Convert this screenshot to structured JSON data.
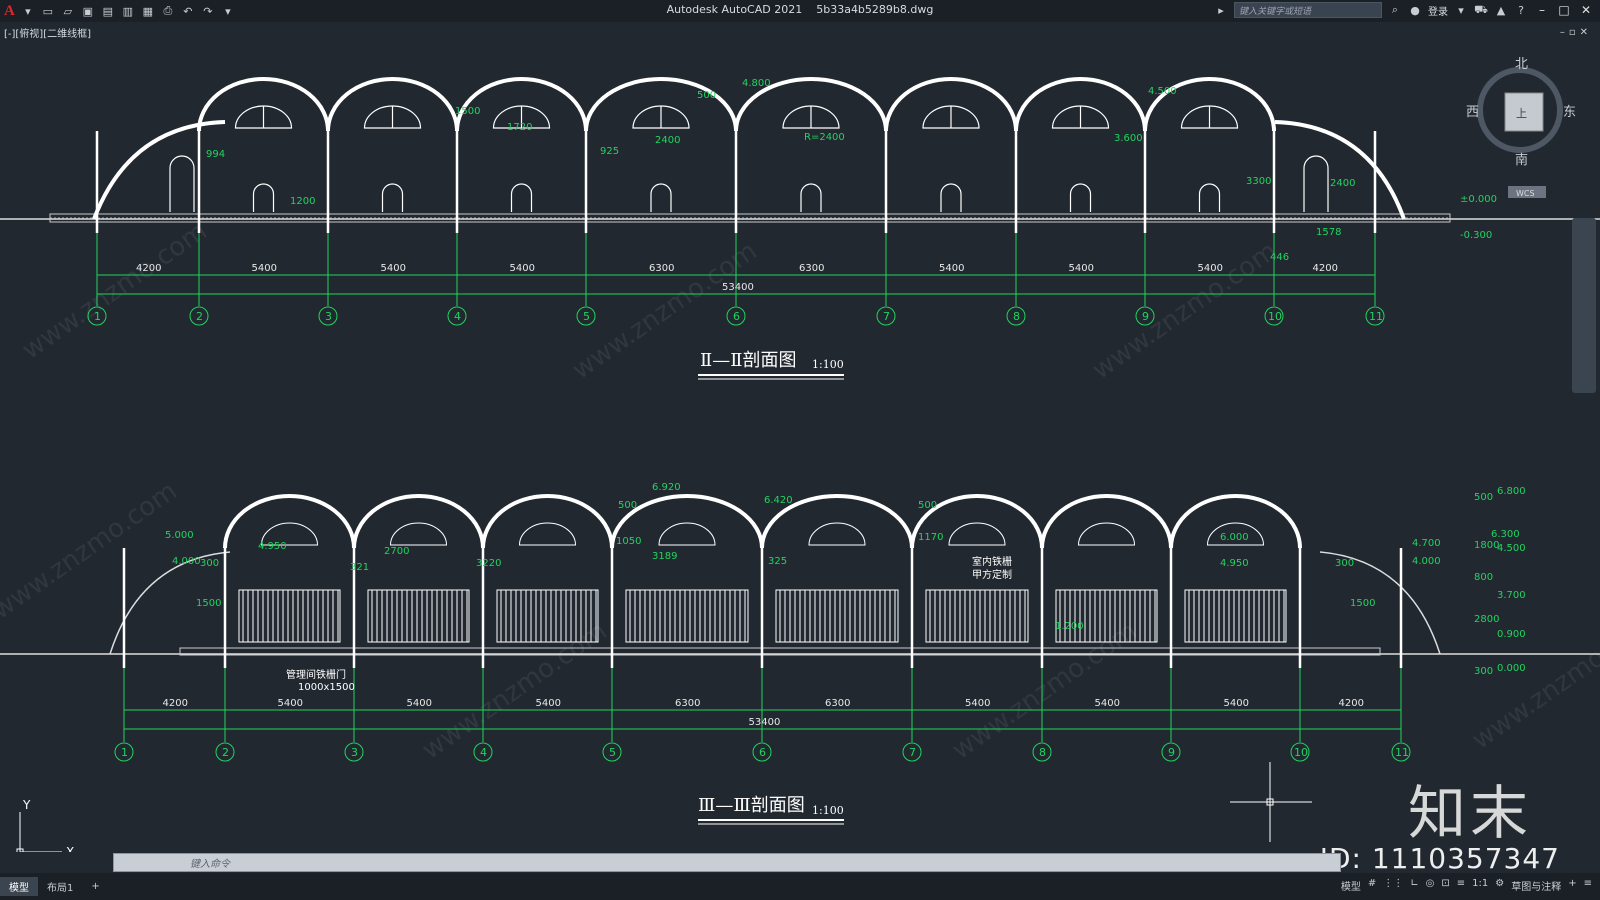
{
  "app": {
    "logo": "A",
    "title": "Autodesk AutoCAD 2021",
    "file": "5b33a4b5289b8.dwg",
    "search_placeholder": "键入关键字或短语",
    "login": "登录"
  },
  "viewport": {
    "label": "[-][俯视][二维线框]"
  },
  "viewcube": {
    "north": "北",
    "south": "南",
    "west": "西",
    "east": "东",
    "face": "上",
    "wcs": "WCS"
  },
  "section1": {
    "title": "Ⅱ—Ⅱ剖面图",
    "scale": "1:100",
    "spans": [
      "4200",
      "5400",
      "5400",
      "5400",
      "6300",
      "6300",
      "5400",
      "5400",
      "5400",
      "4200"
    ],
    "total": "53400",
    "axes": [
      "1",
      "2",
      "3",
      "4",
      "5",
      "6",
      "7",
      "8",
      "9",
      "10",
      "11"
    ],
    "levels": [
      "4.800",
      "4.500",
      "3.600",
      "±0.000",
      "-0.300"
    ],
    "dims": [
      "994",
      "1200",
      "1500",
      "1720",
      "925",
      "2400",
      "500",
      "3300",
      "2400",
      "1578",
      "446",
      "R=2400"
    ]
  },
  "section2": {
    "title": "Ⅲ—Ⅲ剖面图",
    "scale": "1:100",
    "spans": [
      "4200",
      "5400",
      "5400",
      "5400",
      "6300",
      "6300",
      "5400",
      "5400",
      "5400",
      "4200"
    ],
    "total": "53400",
    "axes": [
      "1",
      "2",
      "3",
      "4",
      "5",
      "6",
      "7",
      "8",
      "9",
      "10",
      "11"
    ],
    "levels": [
      "5.000",
      "4.000",
      "4.950",
      "6.920",
      "6.420",
      "6.000",
      "4.950",
      "4.700",
      "4.000",
      "6.800",
      "6.300",
      "4.500",
      "3.700",
      "0.900",
      "0.000",
      "1.200"
    ],
    "dims": [
      "300",
      "1500",
      "321",
      "2700",
      "3220",
      "1050",
      "500",
      "3189",
      "325",
      "1170",
      "500",
      "1500",
      "300",
      "500",
      "1800",
      "800",
      "2800",
      "300"
    ],
    "notes": [
      "室内铁栅",
      "甲方定制",
      "管理间铁栅门",
      "1000x1500"
    ]
  },
  "commandline": {
    "placeholder": "键入命令"
  },
  "status": {
    "tabs": [
      "模型",
      "布局1",
      "+"
    ],
    "model": "模型",
    "scale": "1:1",
    "workspace": "草图与注释"
  },
  "ucs": {
    "x": "X",
    "y": "Y"
  },
  "watermark": {
    "logo": "知末",
    "id": "ID: 1110357347",
    "site": "www.znzmo.com"
  },
  "colors": {
    "background": "#212830",
    "dimension": "#1fd15a",
    "wall": "#ffffff"
  }
}
